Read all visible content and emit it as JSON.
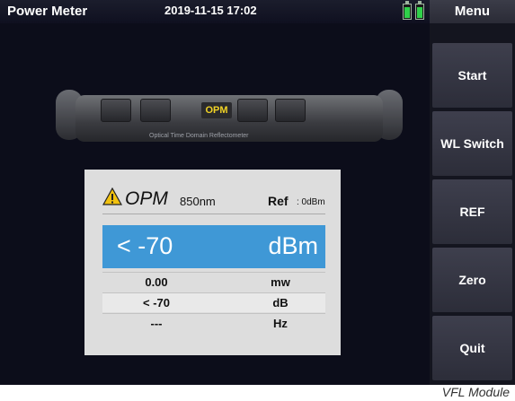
{
  "header": {
    "title": "Power Meter",
    "datetime": "2019-11-15 17:02"
  },
  "sidebar": {
    "menu_label": "Menu",
    "buttons": [
      "Start",
      "WL Switch",
      "REF",
      "Zero",
      "Quit"
    ]
  },
  "device": {
    "key_label": "OPM",
    "caption": "Optical Time Domain Reflectometer"
  },
  "panel": {
    "mode": "OPM",
    "wavelength": "850nm",
    "ref_label": "Ref",
    "ref_value": ": 0dBm",
    "main_value": "< -70",
    "main_unit": "dBm",
    "rows": [
      {
        "value": "0.00",
        "unit": "mw"
      },
      {
        "value": "< -70",
        "unit": "dB"
      },
      {
        "value": "---",
        "unit": "Hz"
      }
    ]
  },
  "caption": "VFL Module",
  "colors": {
    "accent": "#3f98d6",
    "battery": "#2fd14a",
    "opm_label": "#f1d326"
  }
}
